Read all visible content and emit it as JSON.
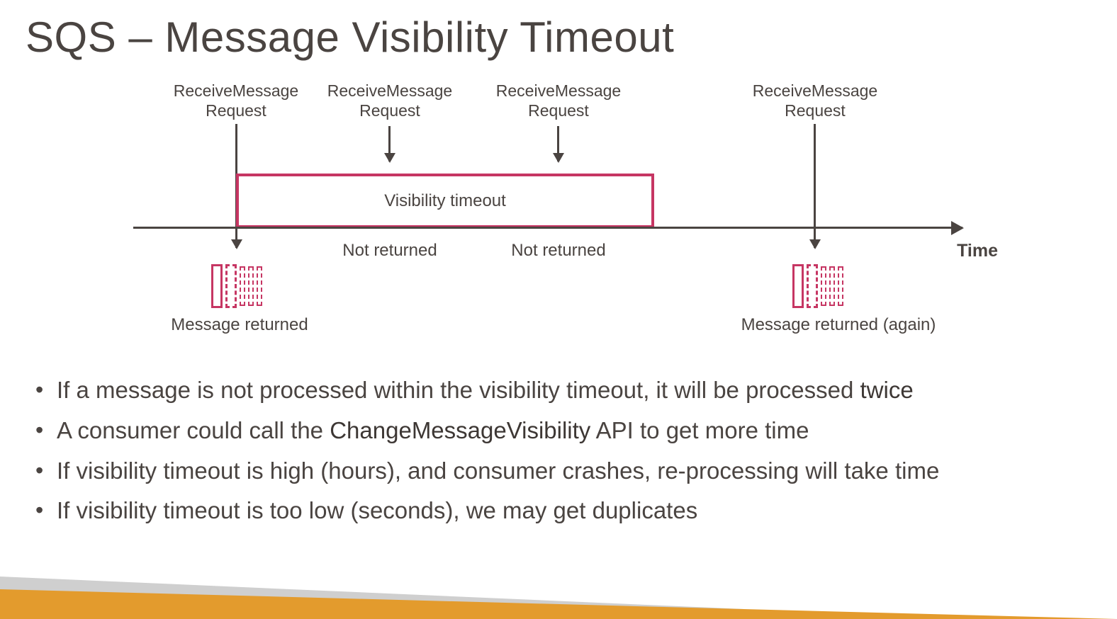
{
  "title": "SQS – Message Visibility Timeout",
  "diagram": {
    "requests": [
      {
        "line1": "ReceiveMessage",
        "line2": "Request"
      },
      {
        "line1": "ReceiveMessage",
        "line2": "Request"
      },
      {
        "line1": "ReceiveMessage",
        "line2": "Request"
      },
      {
        "line1": "ReceiveMessage",
        "line2": "Request"
      }
    ],
    "visibility_box": "Visibility timeout",
    "below_labels": {
      "not_returned_1": "Not returned",
      "not_returned_2": "Not returned"
    },
    "message_returned_1": "Message returned",
    "message_returned_2": "Message returned (again)",
    "time_axis": "Time"
  },
  "bullets": [
    {
      "pre": "If a message is not processed within the visibility timeout, it will be processed ",
      "bold": "twice",
      "post": ""
    },
    {
      "pre": "A consumer could call the ",
      "bold": "ChangeMessageVisibility",
      "post": " API to get more time"
    },
    {
      "pre": "If visibility timeout is high (hours), and consumer crashes, re-processing will take time",
      "bold": "",
      "post": ""
    },
    {
      "pre": "If visibility timeout is too low (seconds), we may get duplicates",
      "bold": "",
      "post": ""
    }
  ]
}
